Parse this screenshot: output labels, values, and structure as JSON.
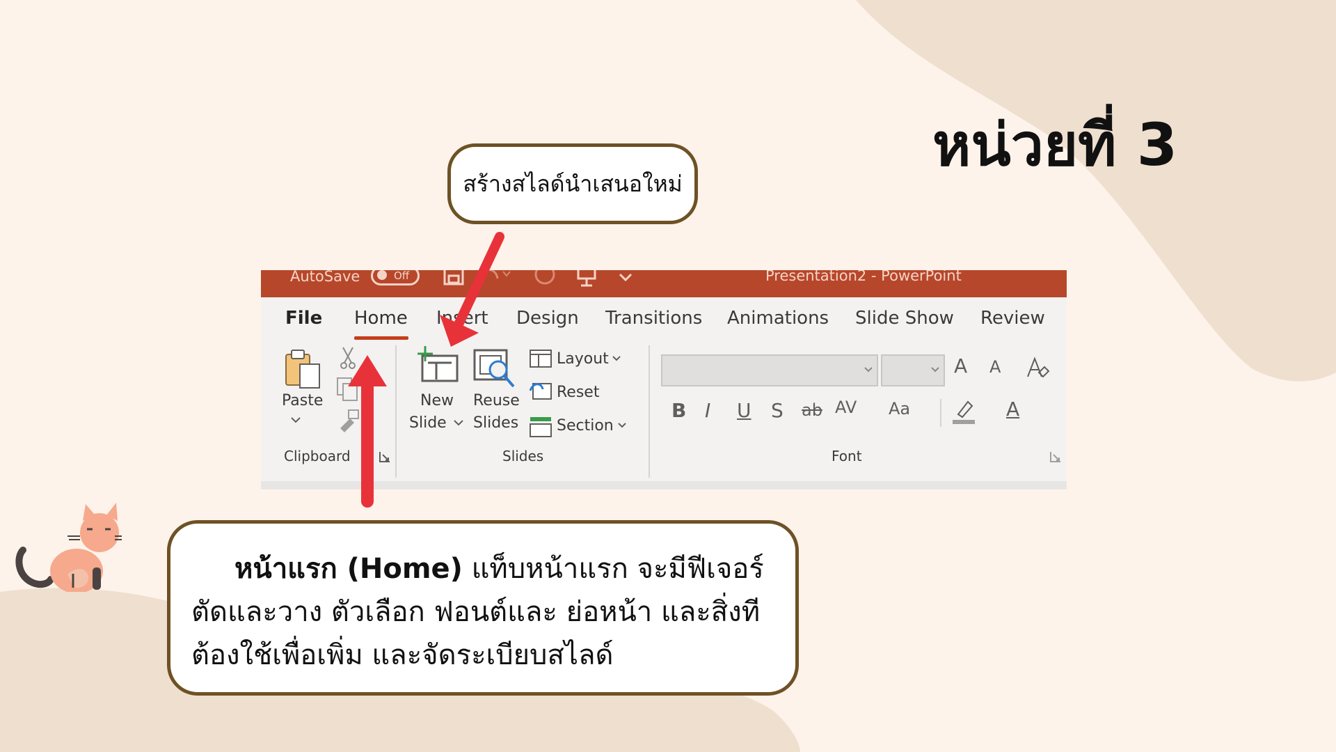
{
  "slide": {
    "title": "หน่วยที่ 3",
    "callout_top": "สร้างสไลด์นำเสนอใหม่",
    "callout_main": {
      "lead": "หน้าแรก (Home)",
      "text": " แท็บหน้าแรก จะมีฟีเจอร์ตัดและวาง ตัวเลือก ฟอนต์และ ย่อหน้า และสิ่งทีต้องใช้เพื่อเพิ่ม และจัดระเบียบสไลด์"
    },
    "arrow_color": "#e8323a",
    "border_color": "#6e5125",
    "background_color": "#fdf3ea",
    "blob_color": "#efdfcf"
  },
  "ribbon": {
    "titlebar": {
      "autosave": "AutoSave",
      "toggle": "Off",
      "document": "Presentation2  -  PowerPoint",
      "color": "#b7472a"
    },
    "tabs": [
      "File",
      "Home",
      "Insert",
      "Design",
      "Transitions",
      "Animations",
      "Slide Show",
      "Review"
    ],
    "active_tab": "Home",
    "clipboard": {
      "paste": "Paste",
      "group": "Clipboard"
    },
    "slides": {
      "new_slide_1": "New",
      "new_slide_2": "Slide",
      "reuse_1": "Reuse",
      "reuse_2": "Slides",
      "layout": "Layout",
      "reset": "Reset",
      "section": "Section",
      "group": "Slides"
    },
    "font": {
      "group": "Font",
      "grow": "A",
      "shrink": "A",
      "bold": "B",
      "italic": "I",
      "underline": "U",
      "shadow": "S",
      "strike": "ab",
      "spacing": "AV",
      "case": "Aa",
      "color": "A"
    }
  }
}
